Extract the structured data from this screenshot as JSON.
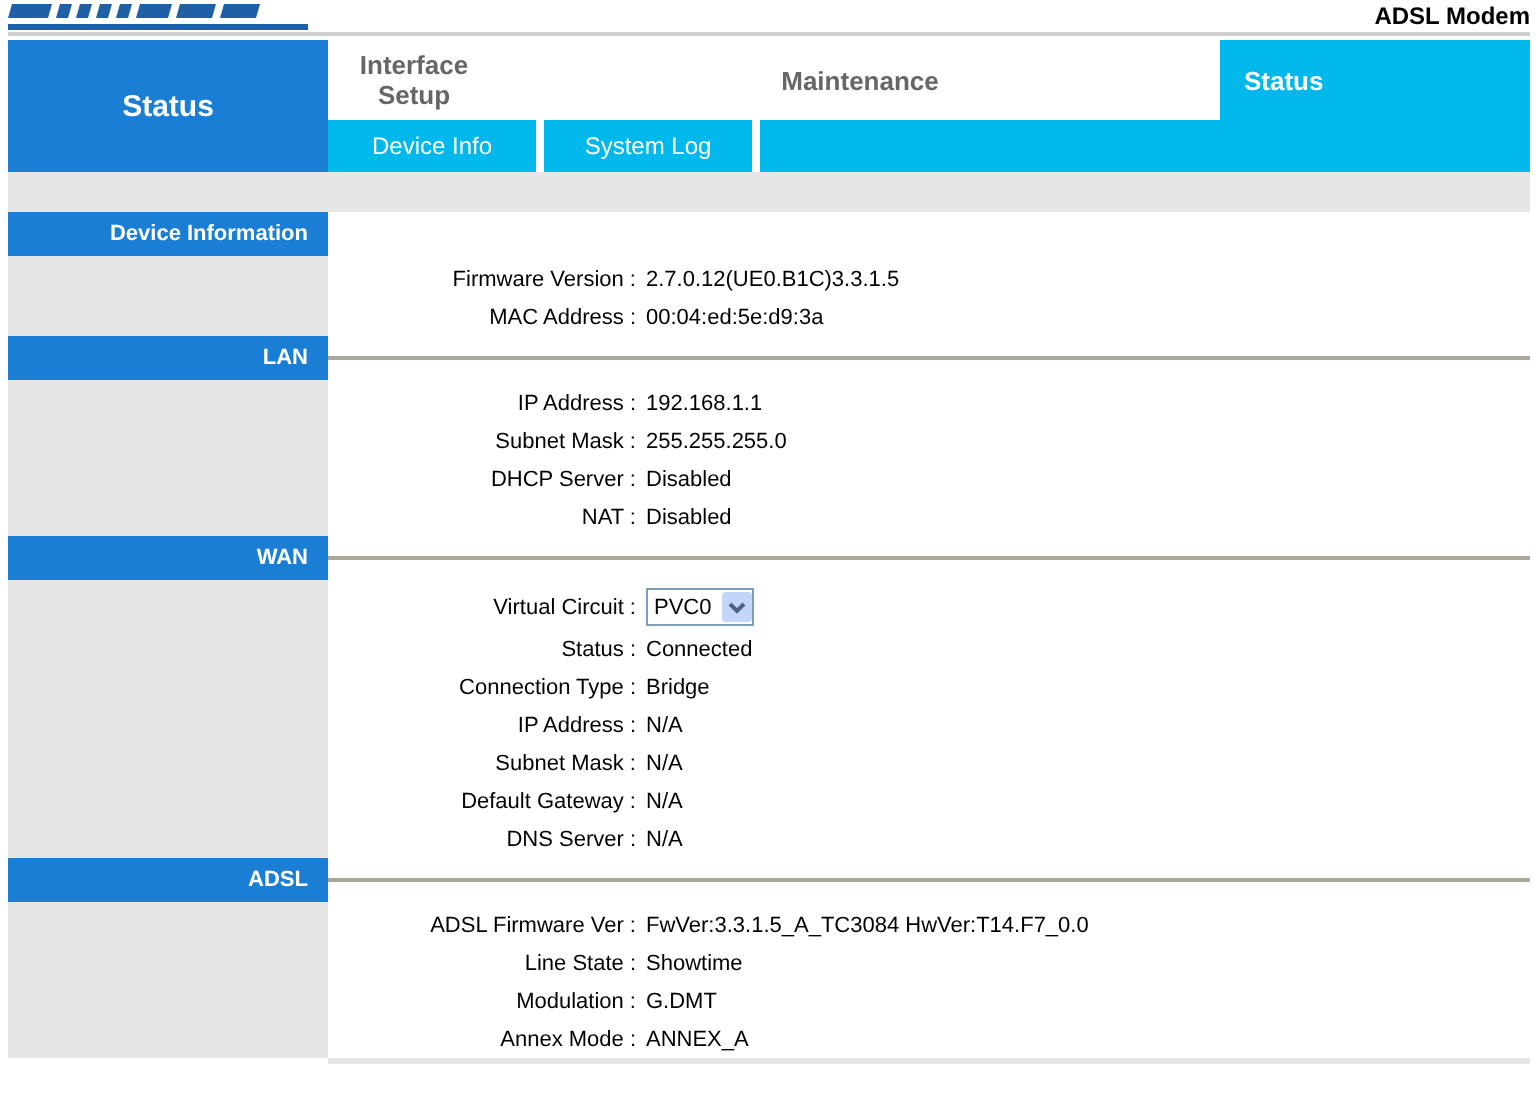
{
  "header": {
    "product": "ADSL Modem"
  },
  "main_nav": {
    "section_title": "Status",
    "tabs": [
      {
        "label": "Interface Setup",
        "selected": false
      },
      {
        "label": "Maintenance",
        "selected": false
      },
      {
        "label": "Status",
        "selected": true
      }
    ]
  },
  "sub_nav": [
    {
      "label": "Device Info"
    },
    {
      "label": "System Log"
    }
  ],
  "sections": [
    {
      "title": "Device Information",
      "rows": [
        {
          "kind": "text",
          "label": "Firmware Version :",
          "value": "2.7.0.12(UE0.B1C)3.3.1.5"
        },
        {
          "kind": "text",
          "label": "MAC Address :",
          "value": "00:04:ed:5e:d9:3a"
        }
      ]
    },
    {
      "title": "LAN",
      "rows": [
        {
          "kind": "text",
          "label": "IP Address :",
          "value": "192.168.1.1"
        },
        {
          "kind": "text",
          "label": "Subnet Mask :",
          "value": "255.255.255.0"
        },
        {
          "kind": "text",
          "label": "DHCP Server :",
          "value": "Disabled"
        },
        {
          "kind": "text",
          "label": "NAT :",
          "value": "Disabled"
        }
      ]
    },
    {
      "title": "WAN",
      "rows": [
        {
          "kind": "select",
          "label": "Virtual Circuit :",
          "value": "PVC0"
        },
        {
          "kind": "text",
          "label": "Status :",
          "value": "Connected"
        },
        {
          "kind": "text",
          "label": "Connection Type :",
          "value": "Bridge"
        },
        {
          "kind": "text",
          "label": "IP Address :",
          "value": "N/A"
        },
        {
          "kind": "text",
          "label": "Subnet Mask :",
          "value": "N/A"
        },
        {
          "kind": "text",
          "label": "Default Gateway :",
          "value": "N/A"
        },
        {
          "kind": "text",
          "label": "DNS Server :",
          "value": "N/A"
        }
      ]
    },
    {
      "title": "ADSL",
      "rows": [
        {
          "kind": "text",
          "label": "ADSL Firmware Ver :",
          "value": "FwVer:3.3.1.5_A_TC3084 HwVer:T14.F7_0.0"
        },
        {
          "kind": "text",
          "label": "Line State :",
          "value": "Showtime"
        },
        {
          "kind": "text",
          "label": "Modulation :",
          "value": "G.DMT"
        },
        {
          "kind": "text",
          "label": "Annex Mode :",
          "value": "ANNEX_A"
        }
      ]
    }
  ]
}
